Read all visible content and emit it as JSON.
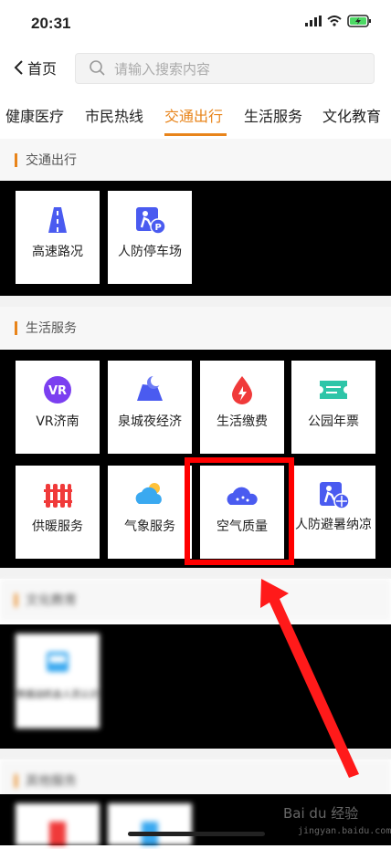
{
  "status": {
    "time": "20:31"
  },
  "nav": {
    "back_label": "首页",
    "search_placeholder": "请输入搜索内容"
  },
  "tabs": [
    {
      "label": "健康医疗",
      "active": false
    },
    {
      "label": "市民热线",
      "active": false
    },
    {
      "label": "交通出行",
      "active": true
    },
    {
      "label": "生活服务",
      "active": false
    },
    {
      "label": "文化教育",
      "active": false
    }
  ],
  "sections": {
    "traffic": {
      "title": "交通出行",
      "items": [
        "高速路况",
        "人防停车场"
      ]
    },
    "life": {
      "title": "生活服务",
      "items": [
        "VR济南",
        "泉城夜经济",
        "生活缴费",
        "公园年票",
        "供暖服务",
        "气象服务",
        "空气质量",
        "人防避暑纳凉"
      ]
    },
    "culture": {
      "title": "文化教育",
      "items": [
        "数据战机会人员认识"
      ]
    },
    "other": {
      "title": "其他服务"
    }
  },
  "watermark": {
    "brand": "Bai du 经验",
    "url": "jingyan.baidu.com"
  },
  "colors": {
    "accent": "#e8841a",
    "highlight": "#ff0000"
  }
}
